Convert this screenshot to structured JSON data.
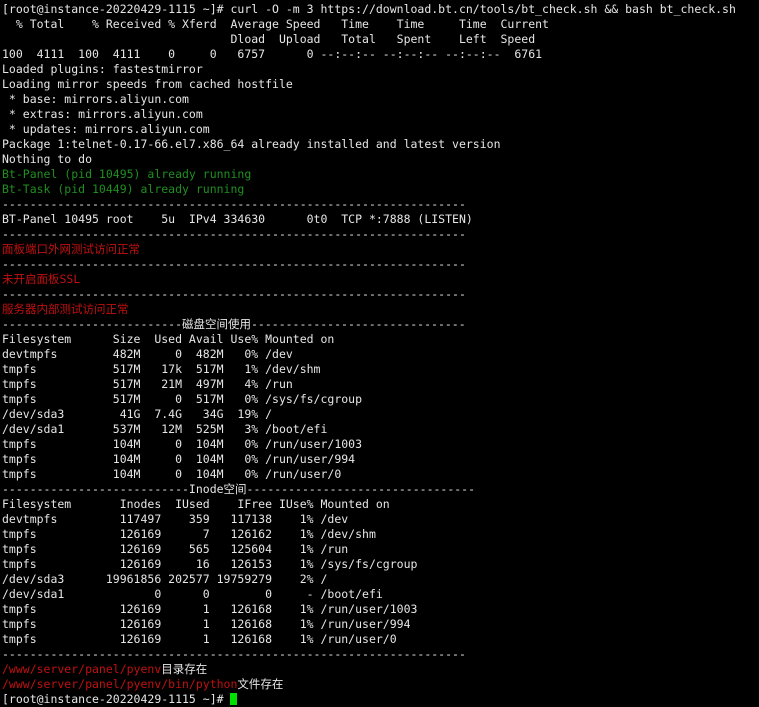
{
  "colors": {
    "default": "#e6e6e6",
    "green": "#1f8f1f",
    "red": "#c01010",
    "cursor": "#00e000"
  },
  "lines": [
    [
      {
        "t": "[root@instance-20220429-1115 ~]# curl -O -m 3 https://download.bt.cn/tools/bt_check.sh && bash bt_check.sh"
      }
    ],
    [
      {
        "t": "  % Total    % Received % Xferd  Average Speed   Time    Time     Time  Current"
      }
    ],
    [
      {
        "t": "                                 Dload  Upload   Total   Spent    Left  Speed"
      }
    ],
    [
      {
        "t": "100  4111  100  4111    0     0   6757      0 --:--:-- --:--:-- --:--:--  6761"
      }
    ],
    [
      {
        "t": "Loaded plugins: fastestmirror"
      }
    ],
    [
      {
        "t": "Loading mirror speeds from cached hostfile"
      }
    ],
    [
      {
        "t": " * base: mirrors.aliyun.com"
      }
    ],
    [
      {
        "t": " * extras: mirrors.aliyun.com"
      }
    ],
    [
      {
        "t": " * updates: mirrors.aliyun.com"
      }
    ],
    [
      {
        "t": "Package 1:telnet-0.17-66.el7.x86_64 already installed and latest version"
      }
    ],
    [
      {
        "t": "Nothing to do"
      }
    ],
    [
      {
        "t": "Bt-Panel (pid 10495) already running",
        "c": "green"
      }
    ],
    [
      {
        "t": "Bt-Task (pid 10449) already running",
        "c": "green"
      }
    ],
    [
      {
        "t": "-------------------------------------------------------------------"
      }
    ],
    [
      {
        "t": "BT-Panel 10495 root    5u  IPv4 334630      0t0  TCP *:7888 (LISTEN)"
      }
    ],
    [
      {
        "t": "-------------------------------------------------------------------"
      }
    ],
    [
      {
        "t": "面板端口外网测试访问正常",
        "c": "red"
      }
    ],
    [
      {
        "t": "-------------------------------------------------------------------"
      }
    ],
    [
      {
        "t": "未开启面板SSL",
        "c": "red"
      }
    ],
    [
      {
        "t": "-------------------------------------------------------------------"
      }
    ],
    [
      {
        "t": "服务器内部测试访问正常",
        "c": "red"
      }
    ],
    [
      {
        "t": "--------------------------磁盘空间使用-------------------------------"
      }
    ],
    [
      {
        "t": "Filesystem      Size  Used Avail Use% Mounted on"
      }
    ],
    [
      {
        "t": "devtmpfs        482M     0  482M   0% /dev"
      }
    ],
    [
      {
        "t": "tmpfs           517M   17k  517M   1% /dev/shm"
      }
    ],
    [
      {
        "t": "tmpfs           517M   21M  497M   4% /run"
      }
    ],
    [
      {
        "t": "tmpfs           517M     0  517M   0% /sys/fs/cgroup"
      }
    ],
    [
      {
        "t": "/dev/sda3        41G  7.4G   34G  19% /"
      }
    ],
    [
      {
        "t": "/dev/sda1       537M   12M  525M   3% /boot/efi"
      }
    ],
    [
      {
        "t": "tmpfs           104M     0  104M   0% /run/user/1003"
      }
    ],
    [
      {
        "t": "tmpfs           104M     0  104M   0% /run/user/994"
      }
    ],
    [
      {
        "t": "tmpfs           104M     0  104M   0% /run/user/0"
      }
    ],
    [
      {
        "t": "---------------------------Inode空间---------------------------------"
      }
    ],
    [
      {
        "t": "Filesystem       Inodes  IUsed    IFree IUse% Mounted on"
      }
    ],
    [
      {
        "t": "devtmpfs         117497    359   117138    1% /dev"
      }
    ],
    [
      {
        "t": "tmpfs            126169      7   126162    1% /dev/shm"
      }
    ],
    [
      {
        "t": "tmpfs            126169    565   125604    1% /run"
      }
    ],
    [
      {
        "t": "tmpfs            126169     16   126153    1% /sys/fs/cgroup"
      }
    ],
    [
      {
        "t": "/dev/sda3      19961856 202577 19759279    2% /"
      }
    ],
    [
      {
        "t": "/dev/sda1             0      0        0     - /boot/efi"
      }
    ],
    [
      {
        "t": "tmpfs            126169      1   126168    1% /run/user/1003"
      }
    ],
    [
      {
        "t": "tmpfs            126169      1   126168    1% /run/user/994"
      }
    ],
    [
      {
        "t": "tmpfs            126169      1   126168    1% /run/user/0"
      }
    ],
    [
      {
        "t": "-------------------------------------------------------------------"
      }
    ],
    [
      {
        "t": "/www/server/panel/pyenv",
        "c": "red"
      },
      {
        "t": "目录存在"
      }
    ],
    [
      {
        "t": "/www/server/panel/pyenv/bin/python",
        "c": "red"
      },
      {
        "t": "文件存在"
      }
    ],
    [
      {
        "t": "[root@instance-20220429-1115 ~]# "
      }
    ]
  ]
}
